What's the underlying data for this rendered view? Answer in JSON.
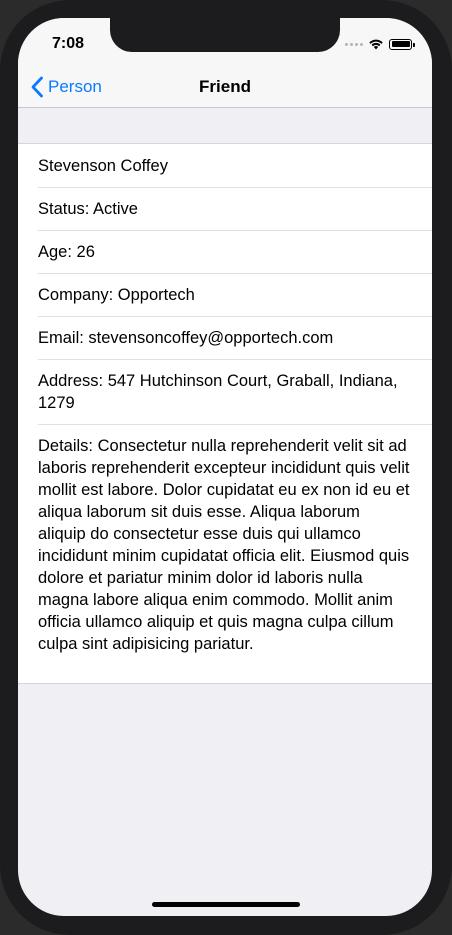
{
  "statusbar": {
    "time": "7:08"
  },
  "navbar": {
    "back_label": "Person",
    "title": "Friend"
  },
  "cells": [
    {
      "text": "Stevenson Coffey"
    },
    {
      "text": "Status: Active"
    },
    {
      "text": "Age: 26"
    },
    {
      "text": "Company: Opportech"
    },
    {
      "text": "Email: stevensoncoffey@opportech.com"
    },
    {
      "text": "Address: 547 Hutchinson Court, Graball, Indiana, 1279"
    },
    {
      "text": "Details: Consectetur nulla reprehenderit velit sit ad laboris reprehenderit excepteur incididunt quis velit mollit est labore. Dolor cupidatat eu ex non id eu et aliqua laborum sit duis esse. Aliqua laborum aliquip do consectetur esse duis qui ullamco incididunt minim cupidatat officia elit. Eiusmod quis dolore et pariatur minim dolor id laboris nulla magna labore aliqua enim commodo. Mollit anim officia ullamco aliquip et quis magna culpa cillum culpa sint adipisicing pariatur."
    }
  ],
  "colors": {
    "accent": "#0a7aff",
    "background": "#efeff4"
  },
  "icons": {
    "back": "chevron-left-icon",
    "wifi": "wifi-icon",
    "battery": "battery-icon",
    "signal": "signal-dots-icon"
  }
}
